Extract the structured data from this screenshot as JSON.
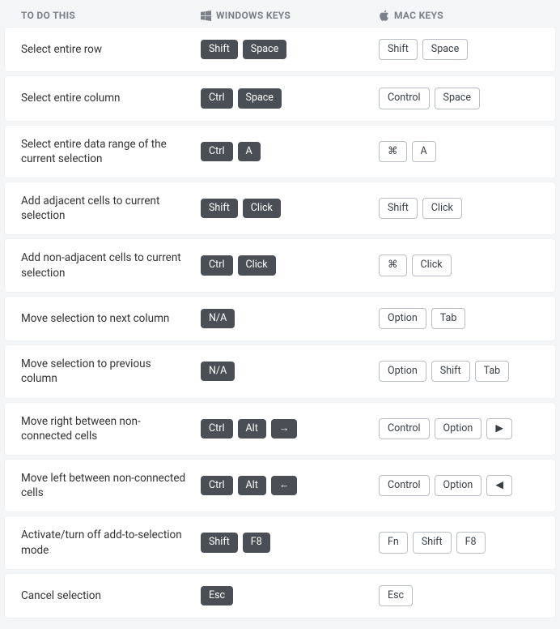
{
  "header": {
    "action": "TO DO THIS",
    "windows": "WINDOWS KEYS",
    "mac": "MAC KEYS"
  },
  "rows": [
    {
      "action": "Select entire row",
      "win": [
        "Shift",
        "Space"
      ],
      "mac": [
        "Shift",
        "Space"
      ]
    },
    {
      "action": "Select entire column",
      "win": [
        "Ctrl",
        "Space"
      ],
      "mac": [
        "Control",
        "Space"
      ]
    },
    {
      "action": "Select entire data range of the current selection",
      "win": [
        "Ctrl",
        "A"
      ],
      "mac": [
        "⌘",
        "A"
      ]
    },
    {
      "action": "Add adjacent cells to current selection",
      "win": [
        "Shift",
        "Click"
      ],
      "mac": [
        "Shift",
        "Click"
      ]
    },
    {
      "action": "Add non-adjacent cells to current selection",
      "win": [
        "Ctrl",
        "Click"
      ],
      "mac": [
        "⌘",
        "Click"
      ]
    },
    {
      "action": "Move selection to next column",
      "win": [
        "N/A"
      ],
      "mac": [
        "Option",
        "Tab"
      ]
    },
    {
      "action": "Move selection to previous column",
      "win": [
        "N/A"
      ],
      "mac": [
        "Option",
        "Shift",
        "Tab"
      ]
    },
    {
      "action": "Move right between non-connected cells",
      "win": [
        "Ctrl",
        "Alt",
        "→"
      ],
      "mac": [
        "Control",
        "Option",
        "▶"
      ]
    },
    {
      "action": "Move left between non-connected cells",
      "win": [
        "Ctrl",
        "Alt",
        "←"
      ],
      "mac": [
        "Control",
        "Option",
        "◀"
      ]
    },
    {
      "action": "Activate/turn off add-to-selection mode",
      "win": [
        "Shift",
        "F8"
      ],
      "mac": [
        "Fn",
        "Shift",
        "F8"
      ]
    },
    {
      "action": "Cancel selection",
      "win": [
        "Esc"
      ],
      "mac": [
        "Esc"
      ]
    }
  ]
}
